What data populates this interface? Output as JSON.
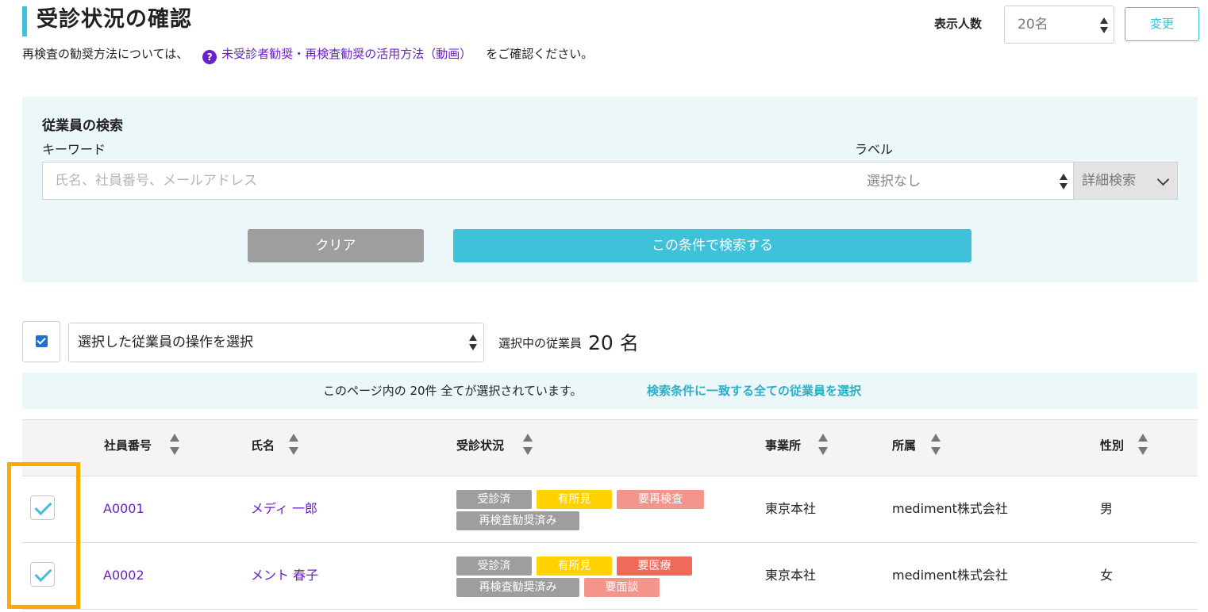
{
  "page": {
    "title": "受診状況の確認",
    "accent_color": "#3fc1d9",
    "link_color": "#6b21c8"
  },
  "display": {
    "label": "表示人数",
    "selected": "20名",
    "change_label": "変更"
  },
  "intro": {
    "prefix": "再検査の勧奨方法については、",
    "help_icon": "?",
    "link_text": "未受診者勧奨・再検査勧奨の活用方法（動画）",
    "suffix": "をご確認ください。"
  },
  "search": {
    "title": "従業員の検索",
    "keyword_label": "キーワード",
    "keyword_value": "",
    "keyword_placeholder": "氏名、社員番号、メールアドレス",
    "label_label": "ラベル",
    "label_selected": "選択なし",
    "detail_label": "詳細検索",
    "clear_label": "クリア",
    "submit_label": "この条件で検索する"
  },
  "bulk": {
    "checked": true,
    "operation_placeholder": "選択した従業員の操作を選択",
    "selected_label": "選択中の従業員",
    "selected_count": "20",
    "selected_unit": "名"
  },
  "notice": {
    "message": "このページ内の 20件 全てが選択されています。",
    "select_all_link": "検索条件に一致する全ての従業員を選択"
  },
  "table": {
    "columns": {
      "employee_id": "社員番号",
      "name": "氏名",
      "status": "受診状況",
      "office": "事業所",
      "department": "所属",
      "gender": "性別"
    },
    "rows": [
      {
        "checked": true,
        "employee_id": "A0001",
        "name": "メディ 一郎",
        "badges": [
          {
            "text": "受診済",
            "color": "#9e9e9e"
          },
          {
            "text": "有所見",
            "color": "#ffd200"
          },
          {
            "text": "要再検査",
            "color": "#f3958a"
          },
          {
            "text": "再検査勧奨済み",
            "color": "#9e9e9e"
          }
        ],
        "office": "東京本社",
        "department": "mediment株式会社",
        "gender": "男"
      },
      {
        "checked": true,
        "employee_id": "A0002",
        "name": "メント 春子",
        "badges": [
          {
            "text": "受診済",
            "color": "#9e9e9e"
          },
          {
            "text": "有所見",
            "color": "#ffd200"
          },
          {
            "text": "要医療",
            "color": "#f06a5c"
          },
          {
            "text": "再検査勧奨済み",
            "color": "#9e9e9e"
          },
          {
            "text": "要面談",
            "color": "#f3958a"
          }
        ],
        "office": "東京本社",
        "department": "mediment株式会社",
        "gender": "女"
      }
    ]
  },
  "highlight_color": "#ffa800"
}
